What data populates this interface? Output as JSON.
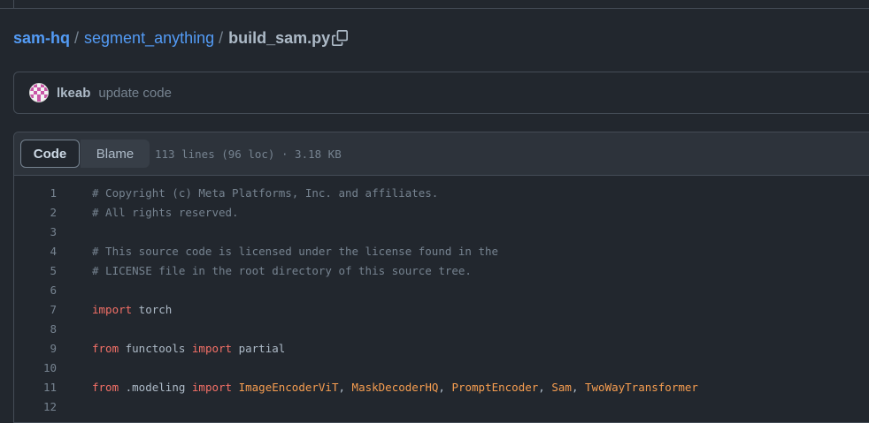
{
  "breadcrumb": {
    "repo": "sam-hq",
    "folder": "segment_anything",
    "file": "build_sam.py",
    "separator": "/",
    "copy_icon": "copy-icon"
  },
  "commit": {
    "avatar_icon": "identicon-avatar",
    "author": "lkeab",
    "message": "update code"
  },
  "file_header": {
    "tabs": [
      {
        "label": "Code",
        "active": true
      },
      {
        "label": "Blame",
        "active": false
      }
    ],
    "meta": "113 lines (96 loc) · 3.18 KB"
  },
  "colors": {
    "background": "#22272e",
    "link": "#539bf5",
    "keyword": "#f47067",
    "class_name": "#f69d50",
    "comment": "#768390"
  },
  "code": {
    "lines": [
      {
        "number": "1",
        "tokens": [
          {
            "type": "comment",
            "text": "# Copyright (c) Meta Platforms, Inc. and affiliates."
          }
        ]
      },
      {
        "number": "2",
        "tokens": [
          {
            "type": "comment",
            "text": "# All rights reserved."
          }
        ]
      },
      {
        "number": "3",
        "tokens": []
      },
      {
        "number": "4",
        "tokens": [
          {
            "type": "comment",
            "text": "# This source code is licensed under the license found in the"
          }
        ]
      },
      {
        "number": "5",
        "tokens": [
          {
            "type": "comment",
            "text": "# LICENSE file in the root directory of this source tree."
          }
        ]
      },
      {
        "number": "6",
        "tokens": []
      },
      {
        "number": "7",
        "tokens": [
          {
            "type": "keyword",
            "text": "import"
          },
          {
            "type": "plain",
            "text": " torch"
          }
        ]
      },
      {
        "number": "8",
        "tokens": []
      },
      {
        "number": "9",
        "tokens": [
          {
            "type": "keyword",
            "text": "from"
          },
          {
            "type": "plain",
            "text": " functools "
          },
          {
            "type": "keyword",
            "text": "import"
          },
          {
            "type": "plain",
            "text": " partial"
          }
        ]
      },
      {
        "number": "10",
        "tokens": []
      },
      {
        "number": "11",
        "tokens": [
          {
            "type": "keyword",
            "text": "from"
          },
          {
            "type": "plain",
            "text": " .modeling "
          },
          {
            "type": "keyword",
            "text": "import"
          },
          {
            "type": "plain",
            "text": " "
          },
          {
            "type": "class",
            "text": "ImageEncoderViT"
          },
          {
            "type": "plain",
            "text": ", "
          },
          {
            "type": "class",
            "text": "MaskDecoderHQ"
          },
          {
            "type": "plain",
            "text": ", "
          },
          {
            "type": "class",
            "text": "PromptEncoder"
          },
          {
            "type": "plain",
            "text": ", "
          },
          {
            "type": "class",
            "text": "Sam"
          },
          {
            "type": "plain",
            "text": ", "
          },
          {
            "type": "class",
            "text": "TwoWayTransformer"
          }
        ]
      },
      {
        "number": "12",
        "tokens": []
      }
    ]
  }
}
